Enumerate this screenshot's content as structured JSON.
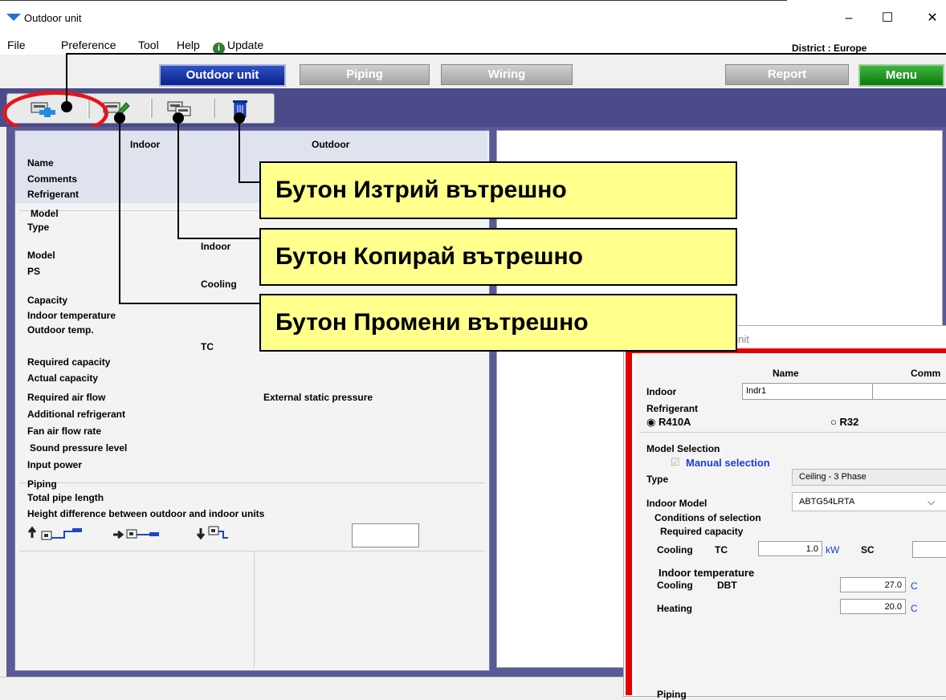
{
  "window": {
    "title": "Outdoor unit",
    "minimize": "–",
    "maximize": "☐",
    "close": "✕"
  },
  "menu": {
    "file": "File",
    "preference": "Preference",
    "tool": "Tool",
    "help": "Help",
    "update": "Update",
    "district": "District : Europe"
  },
  "tabs": {
    "outdoor": "Outdoor unit",
    "piping": "Piping",
    "wiring": "Wiring",
    "report": "Report",
    "menu": "Menu"
  },
  "toolbar_icons": [
    "add-indoor-icon",
    "edit-indoor-icon",
    "copy-indoor-icon",
    "delete-indoor-icon"
  ],
  "left": {
    "col_indoor": "Indoor",
    "col_outdoor": "Outdoor",
    "name": "Name",
    "comments": "Comments",
    "refrigerant": "Refrigerant",
    "model_section": "Model",
    "type": "Type",
    "indoor_partial": "Indoor",
    "model": "Model",
    "ps": "PS",
    "cooling": "Cooling",
    "capacity": "Capacity",
    "indoor_temperature": "Indoor temperature",
    "outdoor_temp": "Outdoor temp.",
    "tc": "TC",
    "required_capacity": "Required capacity",
    "actual_capacity": "Actual capacity",
    "required_air_flow": "Required air flow",
    "external_static_pressure": "External static pressure",
    "additional_refrigerant": "Additional refrigerant",
    "fan_air_flow_rate": "Fan air flow rate",
    "sound_pressure_level": "Sound pressure level",
    "input_power": "Input power",
    "piping_section": "Piping",
    "total_pipe_length": "Total pipe length",
    "height_difference": "Height difference between outdoor and indoor units"
  },
  "callouts": {
    "delete": "Бутон Изтрий вътрешно",
    "copy": "Бутон Копирай вътрешно",
    "edit": "Бутон Промени вътрешно"
  },
  "dialog": {
    "title_fragment": "unit",
    "col_name": "Name",
    "col_comm": "Comm",
    "indoor_label": "Indoor",
    "indoor_name_value": "Indr1",
    "refrigerant": "Refrigerant",
    "r410a": "R410A",
    "r32": "R32",
    "r410a_selected": true,
    "model_selection": "Model Selection",
    "manual_selection": "Manual selection",
    "manual_checked": true,
    "type_label": "Type",
    "type_value": "Ceiling - 3 Phase",
    "indoor_model_label": "Indoor Model",
    "indoor_model_value": "ABTG54LRTA",
    "conditions": "Conditions of selection",
    "required_capacity": "Required capacity",
    "cooling": "Cooling",
    "tc": "TC",
    "tc_value": "1.0",
    "kw": "kW",
    "sc": "SC",
    "indoor_temperature": "Indoor temperature",
    "cooling2": "Cooling",
    "dbt": "DBT",
    "cooling_dbt_value": "27.0",
    "heating": "Heating",
    "heating_value": "20.0",
    "unit_c": "C",
    "piping": "Piping"
  },
  "colors": {
    "accent": "#0c1f8c",
    "frame": "#4b4b8c",
    "callout": "#ffff8c",
    "highlight_red": "#e50000"
  }
}
